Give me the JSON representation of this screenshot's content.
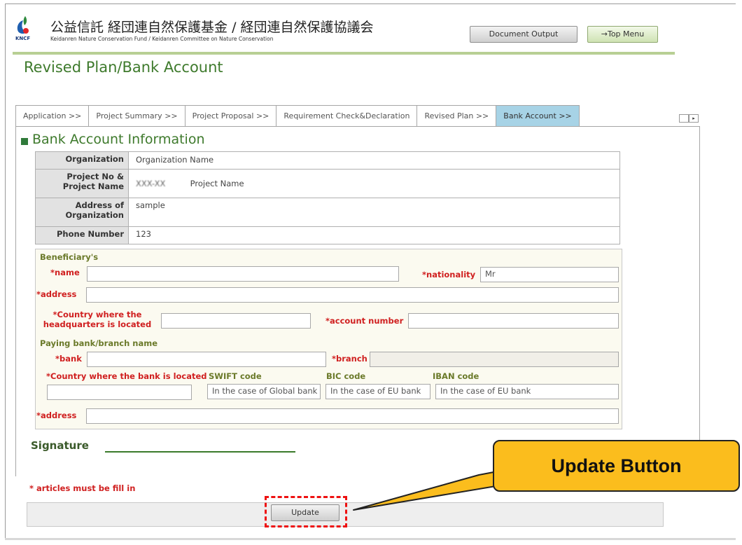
{
  "header": {
    "logo_text": "KNCF",
    "org_name_jp": "公益信託 経団連自然保護基金 / 経団連自然保護協議会",
    "org_name_en": "Keidanren Nature Conservation Fund / Keidanren Committee on Nature Conservation",
    "document_output_label": "Document Output",
    "top_menu_label": "→Top Menu"
  },
  "page": {
    "title": "Revised Plan/Bank Account"
  },
  "tabs": [
    {
      "label": "Application >>"
    },
    {
      "label": "Project Summary >>"
    },
    {
      "label": "Project Proposal >>"
    },
    {
      "label": "Requirement Check&Declaration"
    },
    {
      "label": "Revised Plan >>"
    },
    {
      "label": "Bank Account >>",
      "active": true
    }
  ],
  "section": {
    "title": "Bank Account Information"
  },
  "info": {
    "organization_label": "Organization",
    "organization_value": "Organization Name",
    "project_label_1": "Project No &",
    "project_label_2": "Project Name",
    "project_no_value": "XXX-XX",
    "project_name_value": "Project Name",
    "address_label_1": "Address of",
    "address_label_2": "Organization",
    "address_value": "sample",
    "phone_label": "Phone Number",
    "phone_value": "123"
  },
  "beneficiary": {
    "heading": "Beneficiary's",
    "name_label": "*name",
    "name_value": "",
    "nationality_label": "*nationality",
    "nationality_value": "Mr",
    "address_label": "*address",
    "address_value": "",
    "hq_country_label_1": "*Country where the",
    "hq_country_label_2": "headquarters is located",
    "hq_country_value": "",
    "account_number_label": "*account number",
    "account_number_value": ""
  },
  "paying_bank": {
    "heading": "Paying bank/branch name",
    "bank_label": "*bank",
    "bank_value": "",
    "branch_label": "*branch",
    "branch_value": "",
    "bank_country_label": "*Country where the bank is located",
    "bank_country_value": "",
    "swift_label": "SWIFT code",
    "swift_placeholder": "In the case of Global bank",
    "bic_label": "BIC code",
    "bic_placeholder": "In the case of EU bank",
    "iban_label": "IBAN code",
    "iban_placeholder": "In the case of EU bank",
    "address_label": "*address",
    "address_value": ""
  },
  "signature": {
    "label": "Signature"
  },
  "footer": {
    "note": "* articles must be fill in",
    "update_label": "Update"
  },
  "annotation": {
    "callout_text": "Update Button",
    "colors": {
      "callout_fill": "#fbbd1d",
      "highlight": "#ee1111"
    }
  }
}
